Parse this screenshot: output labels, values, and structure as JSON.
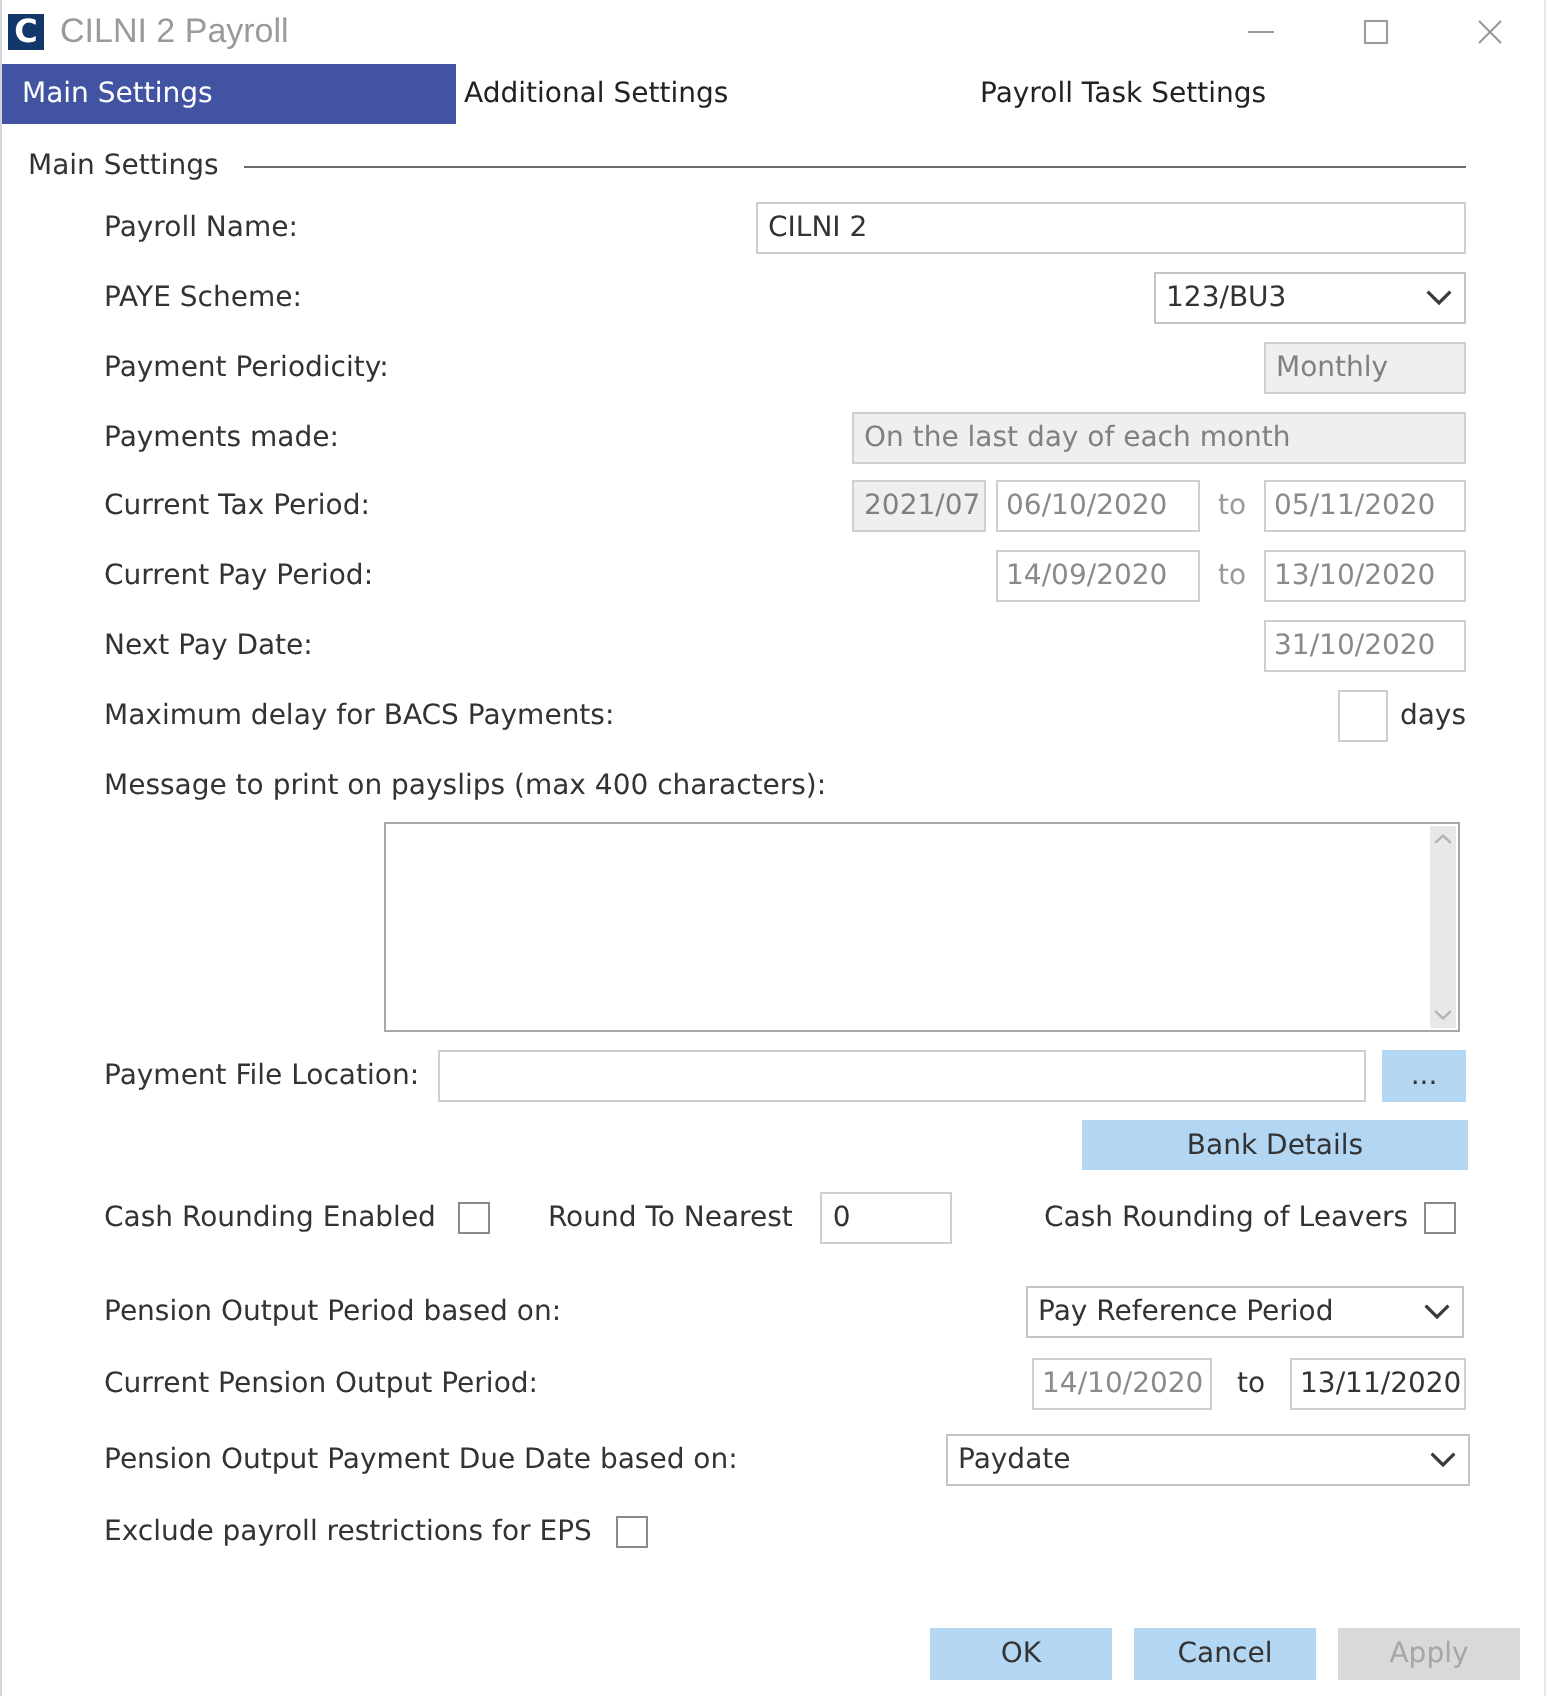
{
  "window": {
    "logo": "C",
    "title": "CILNI 2 Payroll"
  },
  "tabs": [
    {
      "label": "Main Settings",
      "selected": true
    },
    {
      "label": "Additional Settings",
      "selected": false
    },
    {
      "label": "Payroll Task Settings",
      "selected": false
    }
  ],
  "group": {
    "title": "Main Settings"
  },
  "rows": [
    {
      "kind": "text",
      "label": "Payroll Name:",
      "value": "CILNI 2",
      "disabled": false
    },
    {
      "kind": "select",
      "label": "PAYE Scheme:",
      "value": "123/BU3"
    },
    {
      "kind": "text",
      "label": "Payment Periodicity:",
      "value": "Monthly",
      "disabled": true
    },
    {
      "kind": "text",
      "label": "Payments made:",
      "value": "On the last day of each month",
      "disabled": true
    },
    {
      "kind": "range",
      "label": "Current Tax Period:",
      "period": {
        "value": "2021/07",
        "disabled": true
      },
      "from": {
        "value": "06/10/2020",
        "disabled": true
      },
      "separator": "to",
      "to": {
        "value": "05/11/2020",
        "disabled": true
      }
    },
    {
      "kind": "range",
      "label": "Current Pay Period:",
      "from": {
        "value": "14/09/2020",
        "disabled": true
      },
      "separator": "to",
      "to": {
        "value": "13/10/2020",
        "disabled": true
      }
    },
    {
      "kind": "date",
      "label": "Next Pay Date:",
      "value": "31/10/2020",
      "disabled": true
    },
    {
      "kind": "number",
      "label": "Maximum delay for BACS Payments:",
      "unit": "days"
    },
    {
      "kind": "message",
      "label": "Message to print on payslips (max 400 characters):"
    },
    {
      "kind": "file",
      "label": "Payment File Location:",
      "button": "..."
    },
    {
      "kind": "button",
      "button": "Bank Details"
    },
    {
      "kind": "rounding",
      "enabled": {
        "label": "Cash Rounding Enabled",
        "checked": false
      },
      "nearest": {
        "label": "Round To Nearest",
        "value": "0"
      },
      "leavers": {
        "label": "Cash Rounding of Leavers",
        "checked": false
      }
    },
    {
      "kind": "select",
      "label": "Pension Output Period based on:",
      "value": "Pay Reference Period"
    },
    {
      "kind": "range",
      "label": "Current Pension Output Period:",
      "from": {
        "value": "14/10/2020",
        "disabled": true
      },
      "separator": "to",
      "to": {
        "value": "13/11/2020",
        "disabled": false
      }
    },
    {
      "kind": "select",
      "label": "Pension Output Payment Due Date based on:",
      "value": "Paydate"
    },
    {
      "kind": "checkbox",
      "label": "Exclude payroll restrictions for EPS",
      "checked": false
    }
  ],
  "buttons": [
    {
      "label": "OK",
      "disabled": false
    },
    {
      "label": "Cancel",
      "disabled": false
    },
    {
      "label": "Apply",
      "disabled": true
    }
  ]
}
